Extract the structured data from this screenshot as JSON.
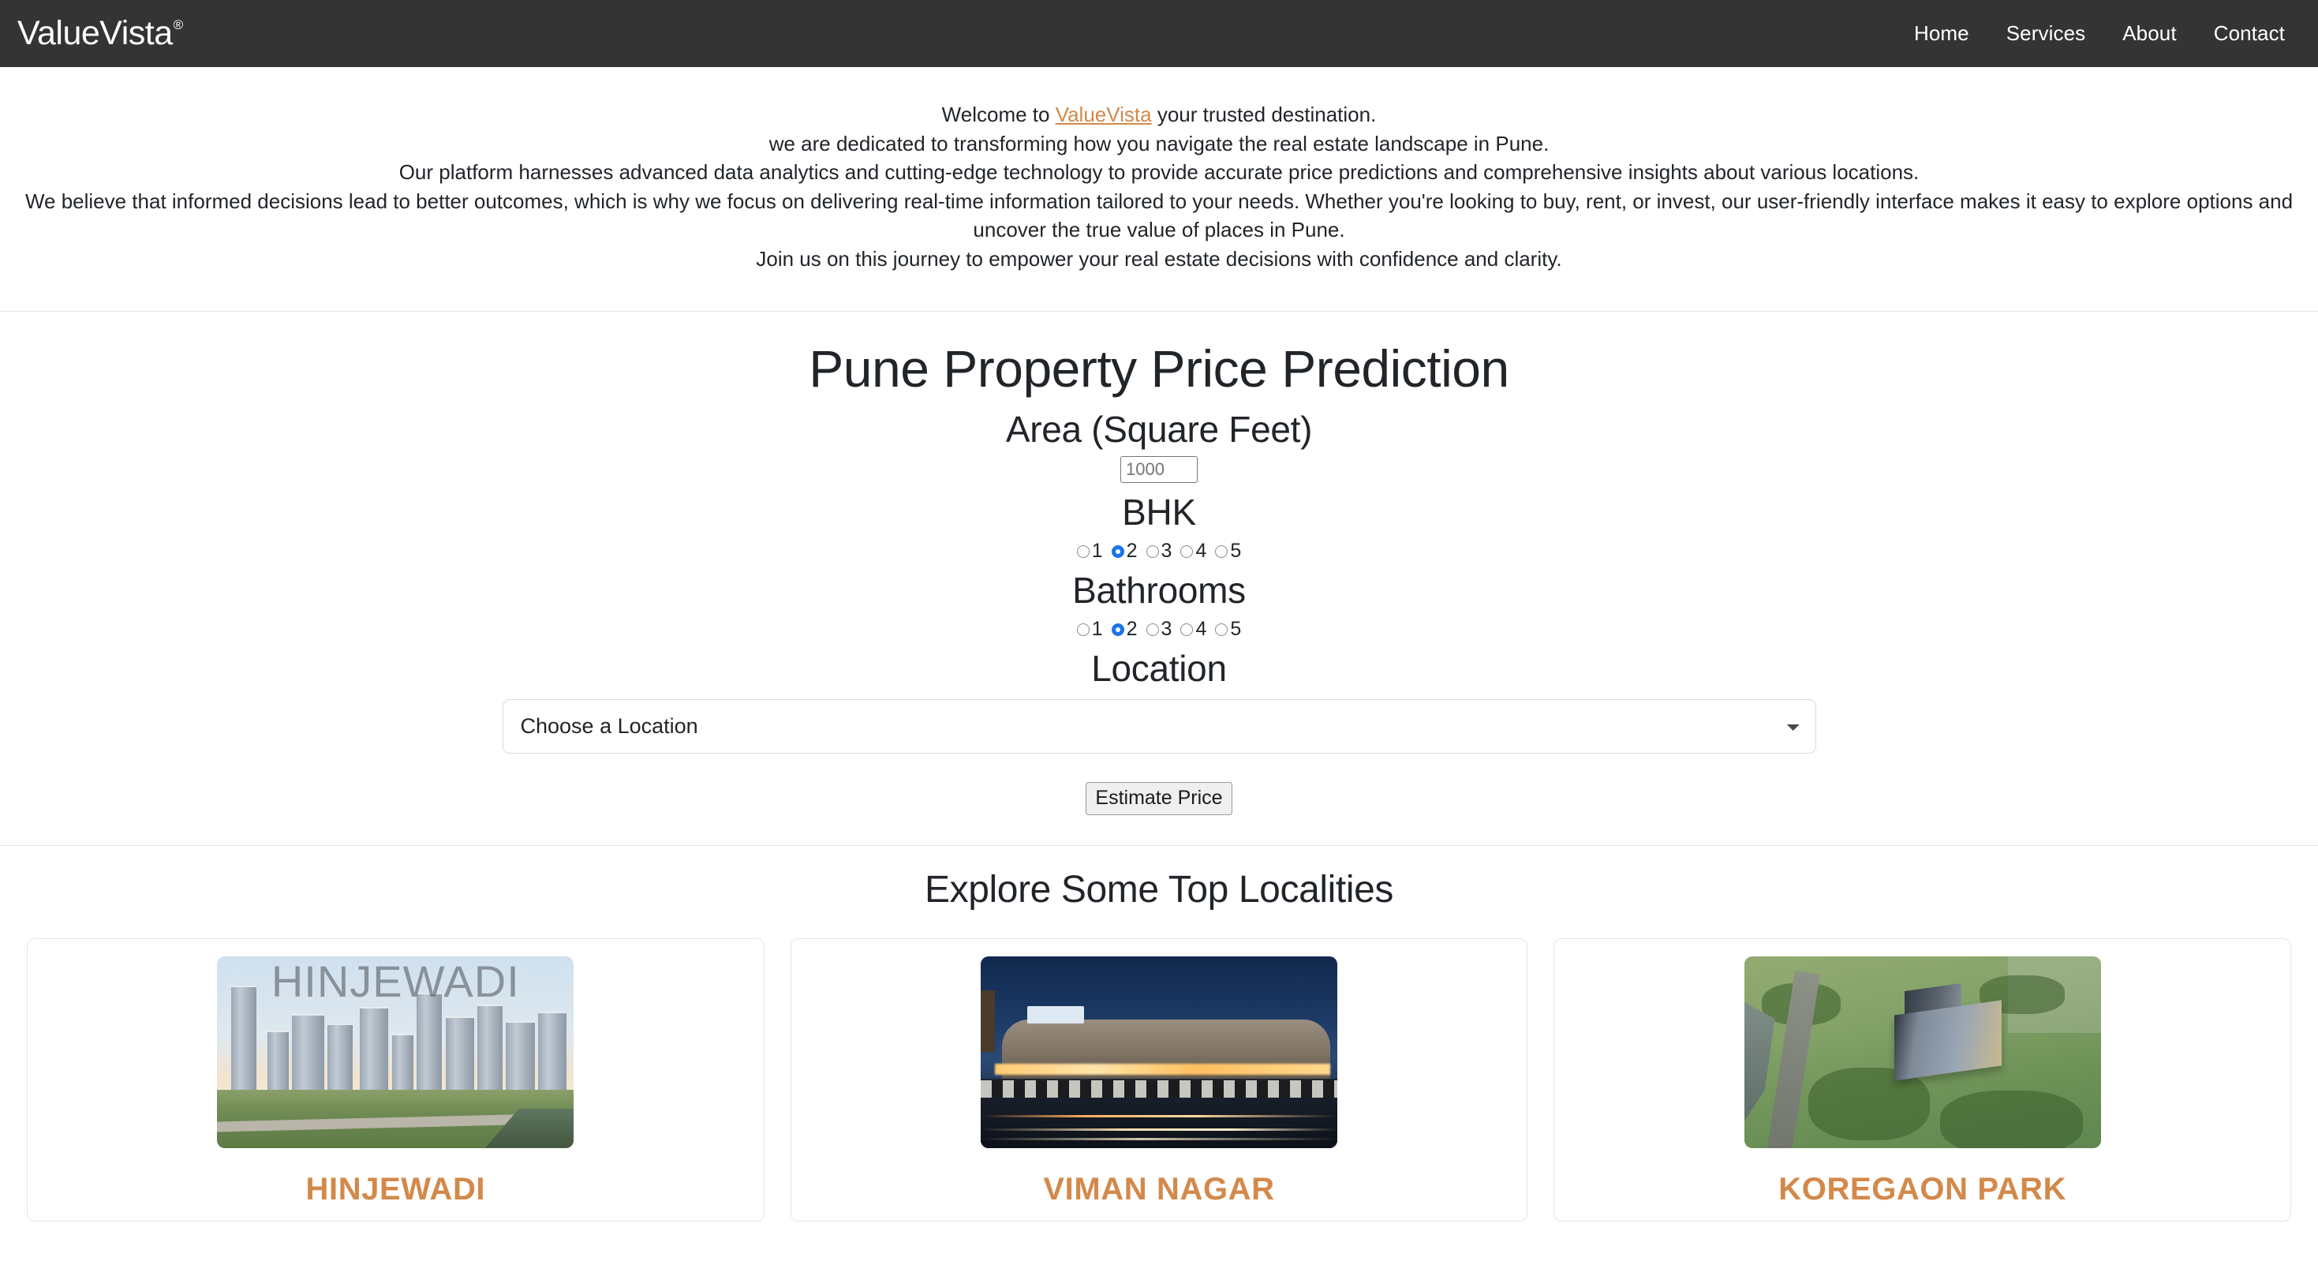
{
  "navbar": {
    "brand": "ValueVista",
    "brand_mark": "®",
    "links": [
      {
        "label": "Home"
      },
      {
        "label": "Services"
      },
      {
        "label": "About"
      },
      {
        "label": "Contact"
      }
    ]
  },
  "intro": {
    "line1_prefix": "Welcome to ",
    "line1_link": "ValueVista",
    "line1_suffix": " your trusted destination.",
    "line2": "we are dedicated to transforming how you navigate the real estate landscape in Pune.",
    "line3": "Our platform harnesses advanced data analytics and cutting-edge technology to provide accurate price predictions and comprehensive insights about various locations.",
    "line4": "We believe that informed decisions lead to better outcomes, which is why we focus on delivering real-time information tailored to your needs. Whether you're looking to buy, rent, or invest, our user-friendly interface makes it easy to explore options and uncover the true value of places in Pune.",
    "line5": "Join us on this journey to empower your real estate decisions with confidence and clarity.",
    "link_color": "#d2894a"
  },
  "predict": {
    "title": "Pune Property Price Prediction",
    "area_label": "Area (Square Feet)",
    "area_placeholder": "1000",
    "area_value": "",
    "bhk_label": "BHK",
    "bhk_options": [
      "1",
      "2",
      "3",
      "4",
      "5"
    ],
    "bhk_selected": "2",
    "bath_label": "Bathrooms",
    "bath_options": [
      "1",
      "2",
      "3",
      "4",
      "5"
    ],
    "bath_selected": "2",
    "location_label": "Location",
    "location_selected": "Choose a Location",
    "submit_label": "Estimate Price",
    "accent_color": "#1a73e8"
  },
  "localities": {
    "title": "Explore Some Top Localities",
    "title_color": "#d2894a",
    "cards": [
      {
        "name": "HINJEWADI",
        "image_overlay_text": "HINJEWADI",
        "image_alt": "hinjewadi-skyline-photo"
      },
      {
        "name": "VIMAN NAGAR",
        "image_overlay_text": "",
        "image_alt": "viman-nagar-mall-photo"
      },
      {
        "name": "KOREGAON PARK",
        "image_overlay_text": "",
        "image_alt": "koregaon-park-aerial-photo"
      }
    ]
  }
}
